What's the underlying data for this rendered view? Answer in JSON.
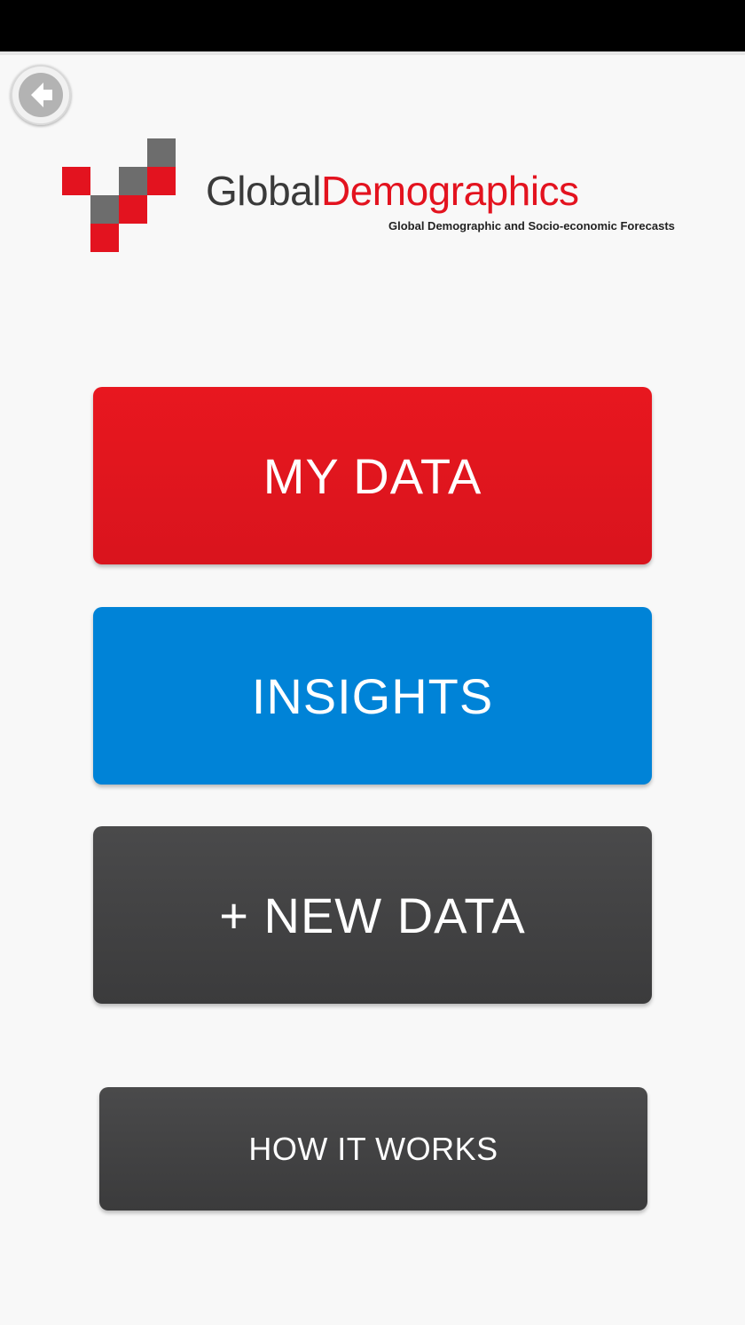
{
  "brand": {
    "name_part1": "Global",
    "name_part2": "Demographics",
    "tagline": "Global Demographic and Socio-economic Forecasts",
    "colors": {
      "red": "#e3131f",
      "dark_gray": "#3a3a3a",
      "mark_gray": "#6d6d6d"
    }
  },
  "navigation": {
    "back_icon": "arrow-left-icon"
  },
  "menu": {
    "my_data_label": "MY DATA",
    "insights_label": "INSIGHTS",
    "new_data_label": "+ NEW DATA",
    "how_it_works_label": "HOW IT WORKS",
    "colors": {
      "my_data": "#e3131f",
      "insights": "#0083d7",
      "new_data": "#434344",
      "how_it_works": "#434344"
    }
  }
}
